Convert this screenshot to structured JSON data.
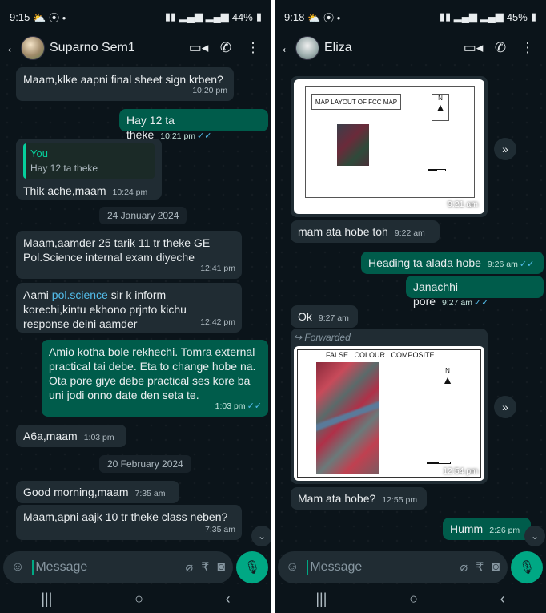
{
  "left": {
    "status": {
      "time": "9:15",
      "battery": "44%"
    },
    "contact": {
      "name": "Suparno Sem1"
    },
    "messages": {
      "m1": {
        "text": "Maam,klke aapni final sheet sign krben?",
        "time": "10:20 pm"
      },
      "m2": {
        "text": "Hay 12 ta theke",
        "time": "10:21 pm"
      },
      "m3": {
        "quote_author": "You",
        "quote_text": "Hay 12 ta theke",
        "text": "Thik ache,maam",
        "time": "10:24 pm"
      },
      "date1": "24 January 2024",
      "m4": {
        "text": "Maam,aamder 25 tarik 11 tr theke GE Pol.Science internal exam diyeche",
        "time": "12:41 pm"
      },
      "m5": {
        "text_before": "Aami ",
        "link": "pol.science",
        "text_after": " sir k inform korechi,kintu ekhono prjnto kichu response deini aamder",
        "time": "12:42 pm"
      },
      "m6": {
        "text": "Amio kotha bole rekhechi. Tomra external practical tai debe. Eta to change hobe na. Ota pore giye debe practical ses kore ba uni jodi onno date den seta te.",
        "time": "1:03 pm"
      },
      "m7": {
        "text": "A6a,maam",
        "time": "1:03 pm"
      },
      "date2": "20 February 2024",
      "m8": {
        "text": "Good morning,maam",
        "time": "7:35 am"
      },
      "m9": {
        "text": "Maam,apni aajk 10 tr theke class neben?",
        "time": "7:35 am"
      }
    },
    "input": {
      "placeholder": "Message"
    }
  },
  "right": {
    "status": {
      "time": "9:18",
      "battery": "45%"
    },
    "contact": {
      "name": "Eliza"
    },
    "messages": {
      "img1": {
        "map_title": "MAP LAYOUT OF FCC MAP",
        "north": "N",
        "time": "9:21 am"
      },
      "m1": {
        "text": "mam ata hobe toh",
        "time": "9:22 am"
      },
      "m2": {
        "text": "Heading ta alada hobe",
        "time": "9:26 am"
      },
      "m3": {
        "text": "Janachhi pore",
        "time": "9:27 am"
      },
      "m4": {
        "text": "Ok",
        "time": "9:27 am"
      },
      "img2": {
        "forwarded": "Forwarded",
        "map_title": "FALSE   COLOUR   COMPOSITE",
        "north": "N",
        "time": "12:54 pm"
      },
      "m5": {
        "text": "Mam ata hobe?",
        "time": "12:55 pm"
      },
      "m6": {
        "text": "Humm",
        "time": "2:26 pm"
      }
    },
    "input": {
      "placeholder": "Message"
    }
  },
  "icons": {
    "back": "back-arrow-icon",
    "video": "video-call-icon",
    "call": "phone-icon",
    "menu": "more-vert-icon"
  },
  "colors": {
    "bg": "#0b141a",
    "incoming": "#202c33",
    "outgoing": "#005c4b",
    "accent": "#00a884",
    "tick": "#53bdeb"
  }
}
